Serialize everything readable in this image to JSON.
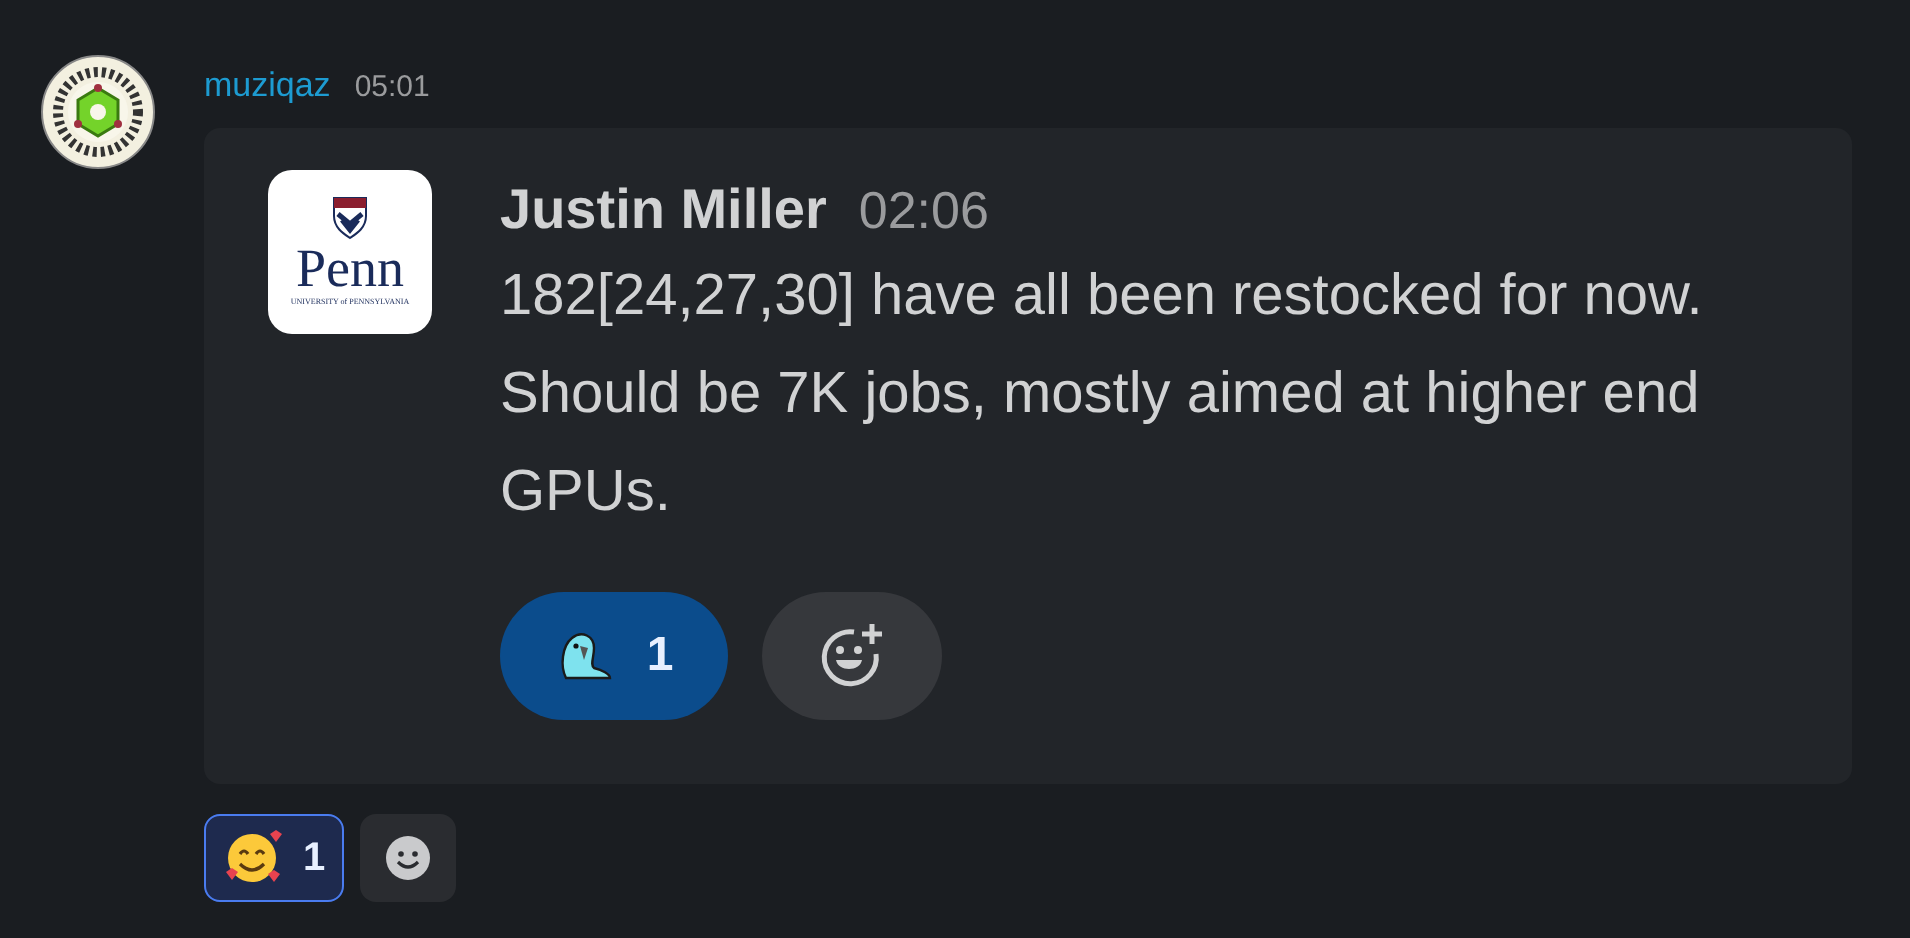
{
  "message": {
    "author": "muziqaz",
    "time": "05:01"
  },
  "embed": {
    "logo": {
      "wordmark": "Penn",
      "subtitle": "UNIVERSITY of PENNSYLVANIA"
    },
    "author": "Justin Miller",
    "time": "02:06",
    "text": "182[24,27,30] have all been restocked for now. Should be 7K jobs, mostly aimed at higher end GPUs.",
    "reactions": [
      {
        "kind": "parrot",
        "count": "1",
        "selected": true
      }
    ]
  },
  "reactions": [
    {
      "kind": "smiling-hearts",
      "count": "1",
      "selected": true
    }
  ]
}
